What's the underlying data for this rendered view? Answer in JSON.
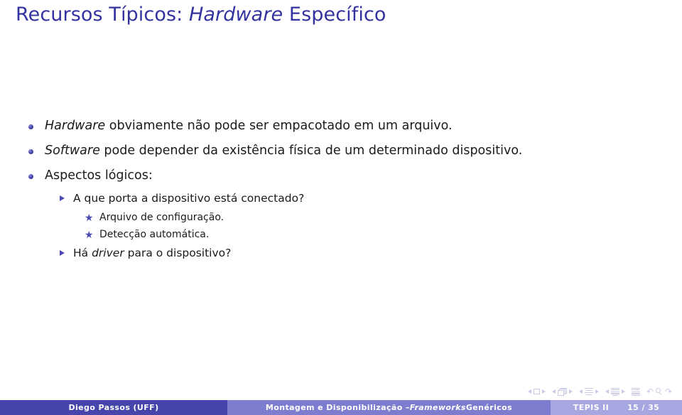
{
  "slide": {
    "title": {
      "prefix": "Recursos Típicos: ",
      "emphasis": "Hardware",
      "suffix": " Específico"
    },
    "accent_color": "#3333a0",
    "bullet_color": "#4a4ab4",
    "content": {
      "item1": {
        "emphasis": "Hardware",
        "text": " obviamente não pode ser empacotado em um arquivo."
      },
      "item2": {
        "emphasis": "Software",
        "text": " pode depender da existência física de um determinado dispositivo."
      },
      "item3": {
        "text": "Aspectos lógicos:"
      },
      "sub1": {
        "text": "A que porta a dispositivo está conectado?"
      },
      "subsub1": {
        "text": "Arquivo de configuração."
      },
      "subsub2": {
        "text": "Detecção automática."
      },
      "sub2": {
        "prefix": "Há ",
        "emphasis": "driver",
        "suffix": " para o dispositivo?"
      },
      "bullet_glyphs": {
        "level3_star": "★"
      }
    },
    "navigation_symbols": {
      "slide_label": "slide-navigation",
      "frame_label": "frame-navigation",
      "subsection_label": "subsection-navigation",
      "section_label": "section-navigation",
      "document_label": "document-navigation",
      "back_glyph": "↶",
      "forward_glyph": "↷"
    },
    "footer": {
      "author": "Diego Passos  (UFF)",
      "subject_prefix": "Montagem e Disponibilização – ",
      "subject_emphasis": "Frameworks",
      "subject_suffix": " Genéricos",
      "course": "TEPIS II",
      "page": "15 / 35",
      "colors": {
        "left": "#4545ab",
        "center": "#7d7dcf",
        "right": "#a6a6e0"
      }
    }
  }
}
